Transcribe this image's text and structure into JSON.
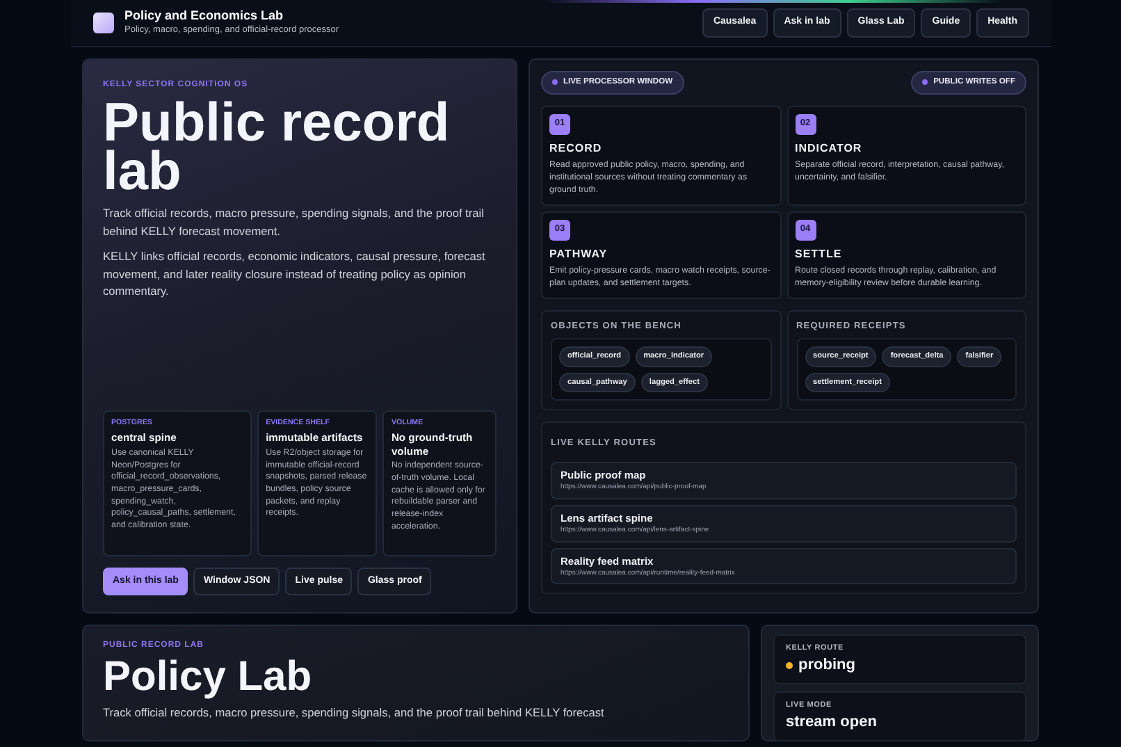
{
  "header": {
    "title": "Policy and Economics Lab",
    "subtitle": "Policy, macro, spending, and official-record processor",
    "nav": [
      "Causalea",
      "Ask in lab",
      "Glass Lab",
      "Guide",
      "Health"
    ]
  },
  "hero": {
    "eyebrow": "KELLY SECTOR COGNITION OS",
    "title": "Public record lab",
    "lead": "Track official records, macro pressure, spending signals, and the proof trail behind KELLY forecast movement.",
    "body": "KELLY links official records, economic indicators, causal pressure, forecast movement, and later reality closure instead of treating policy as opinion commentary.",
    "facts": [
      {
        "label": "POSTGRES",
        "title": "central spine",
        "text": "Use canonical KELLY Neon/Postgres for official_record_observations, macro_pressure_cards, spending_watch, policy_causal_paths, settlement, and calibration state."
      },
      {
        "label": "EVIDENCE SHELF",
        "title": "immutable artifacts",
        "text": "Use R2/object storage for immutable official-record snapshots, parsed release bundles, policy source packets, and replay receipts."
      },
      {
        "label": "VOLUME",
        "title": "No ground-truth volume",
        "text": "No independent source-of-truth volume. Local cache is allowed only for rebuildable parser and release-index acceleration."
      }
    ],
    "buttons": [
      {
        "label": "Ask in this lab",
        "primary": true
      },
      {
        "label": "Window JSON",
        "primary": false
      },
      {
        "label": "Live pulse",
        "primary": false
      },
      {
        "label": "Glass proof",
        "primary": false
      }
    ]
  },
  "processor": {
    "pills": [
      "LIVE PROCESSOR WINDOW",
      "PUBLIC WRITES OFF"
    ],
    "steps": [
      {
        "number": "01",
        "title": "RECORD",
        "text": "Read approved public policy, macro, spending, and institutional sources without treating commentary as ground truth."
      },
      {
        "number": "02",
        "title": "INDICATOR",
        "text": "Separate official record, interpretation, causal pathway, uncertainty, and falsifier."
      },
      {
        "number": "03",
        "title": "PATHWAY",
        "text": "Emit policy-pressure cards, macro watch receipts, source-plan updates, and settlement targets."
      },
      {
        "number": "04",
        "title": "SETTLE",
        "text": "Route closed records through replay, calibration, and memory-eligibility review before durable learning."
      }
    ],
    "bench": {
      "title": "OBJECTS ON THE BENCH",
      "tags": [
        "official_record",
        "macro_indicator",
        "causal_pathway",
        "lagged_effect"
      ]
    },
    "receipts": {
      "title": "REQUIRED RECEIPTS",
      "tags": [
        "source_receipt",
        "forecast_delta",
        "falsifier",
        "settlement_receipt"
      ]
    },
    "routes": {
      "title": "LIVE KELLY ROUTES",
      "items": [
        {
          "name": "Public proof map",
          "url": "https://www.causalea.com/api/public-proof-map"
        },
        {
          "name": "Lens artifact spine",
          "url": "https://www.causalea.com/api/lens-artifact-spine"
        },
        {
          "name": "Reality feed matrix",
          "url": "https://www.causalea.com/api/runtime/reality-feed-matrix"
        }
      ]
    }
  },
  "lab": {
    "eyebrow": "PUBLIC RECORD LAB",
    "title": "Policy Lab",
    "lead": "Track official records, macro pressure, spending signals, and the proof trail behind KELLY forecast"
  },
  "status": [
    {
      "label": "KELLY ROUTE",
      "value": "probing",
      "color": "#f5b324"
    },
    {
      "label": "LIVE MODE",
      "value": "stream open"
    }
  ]
}
